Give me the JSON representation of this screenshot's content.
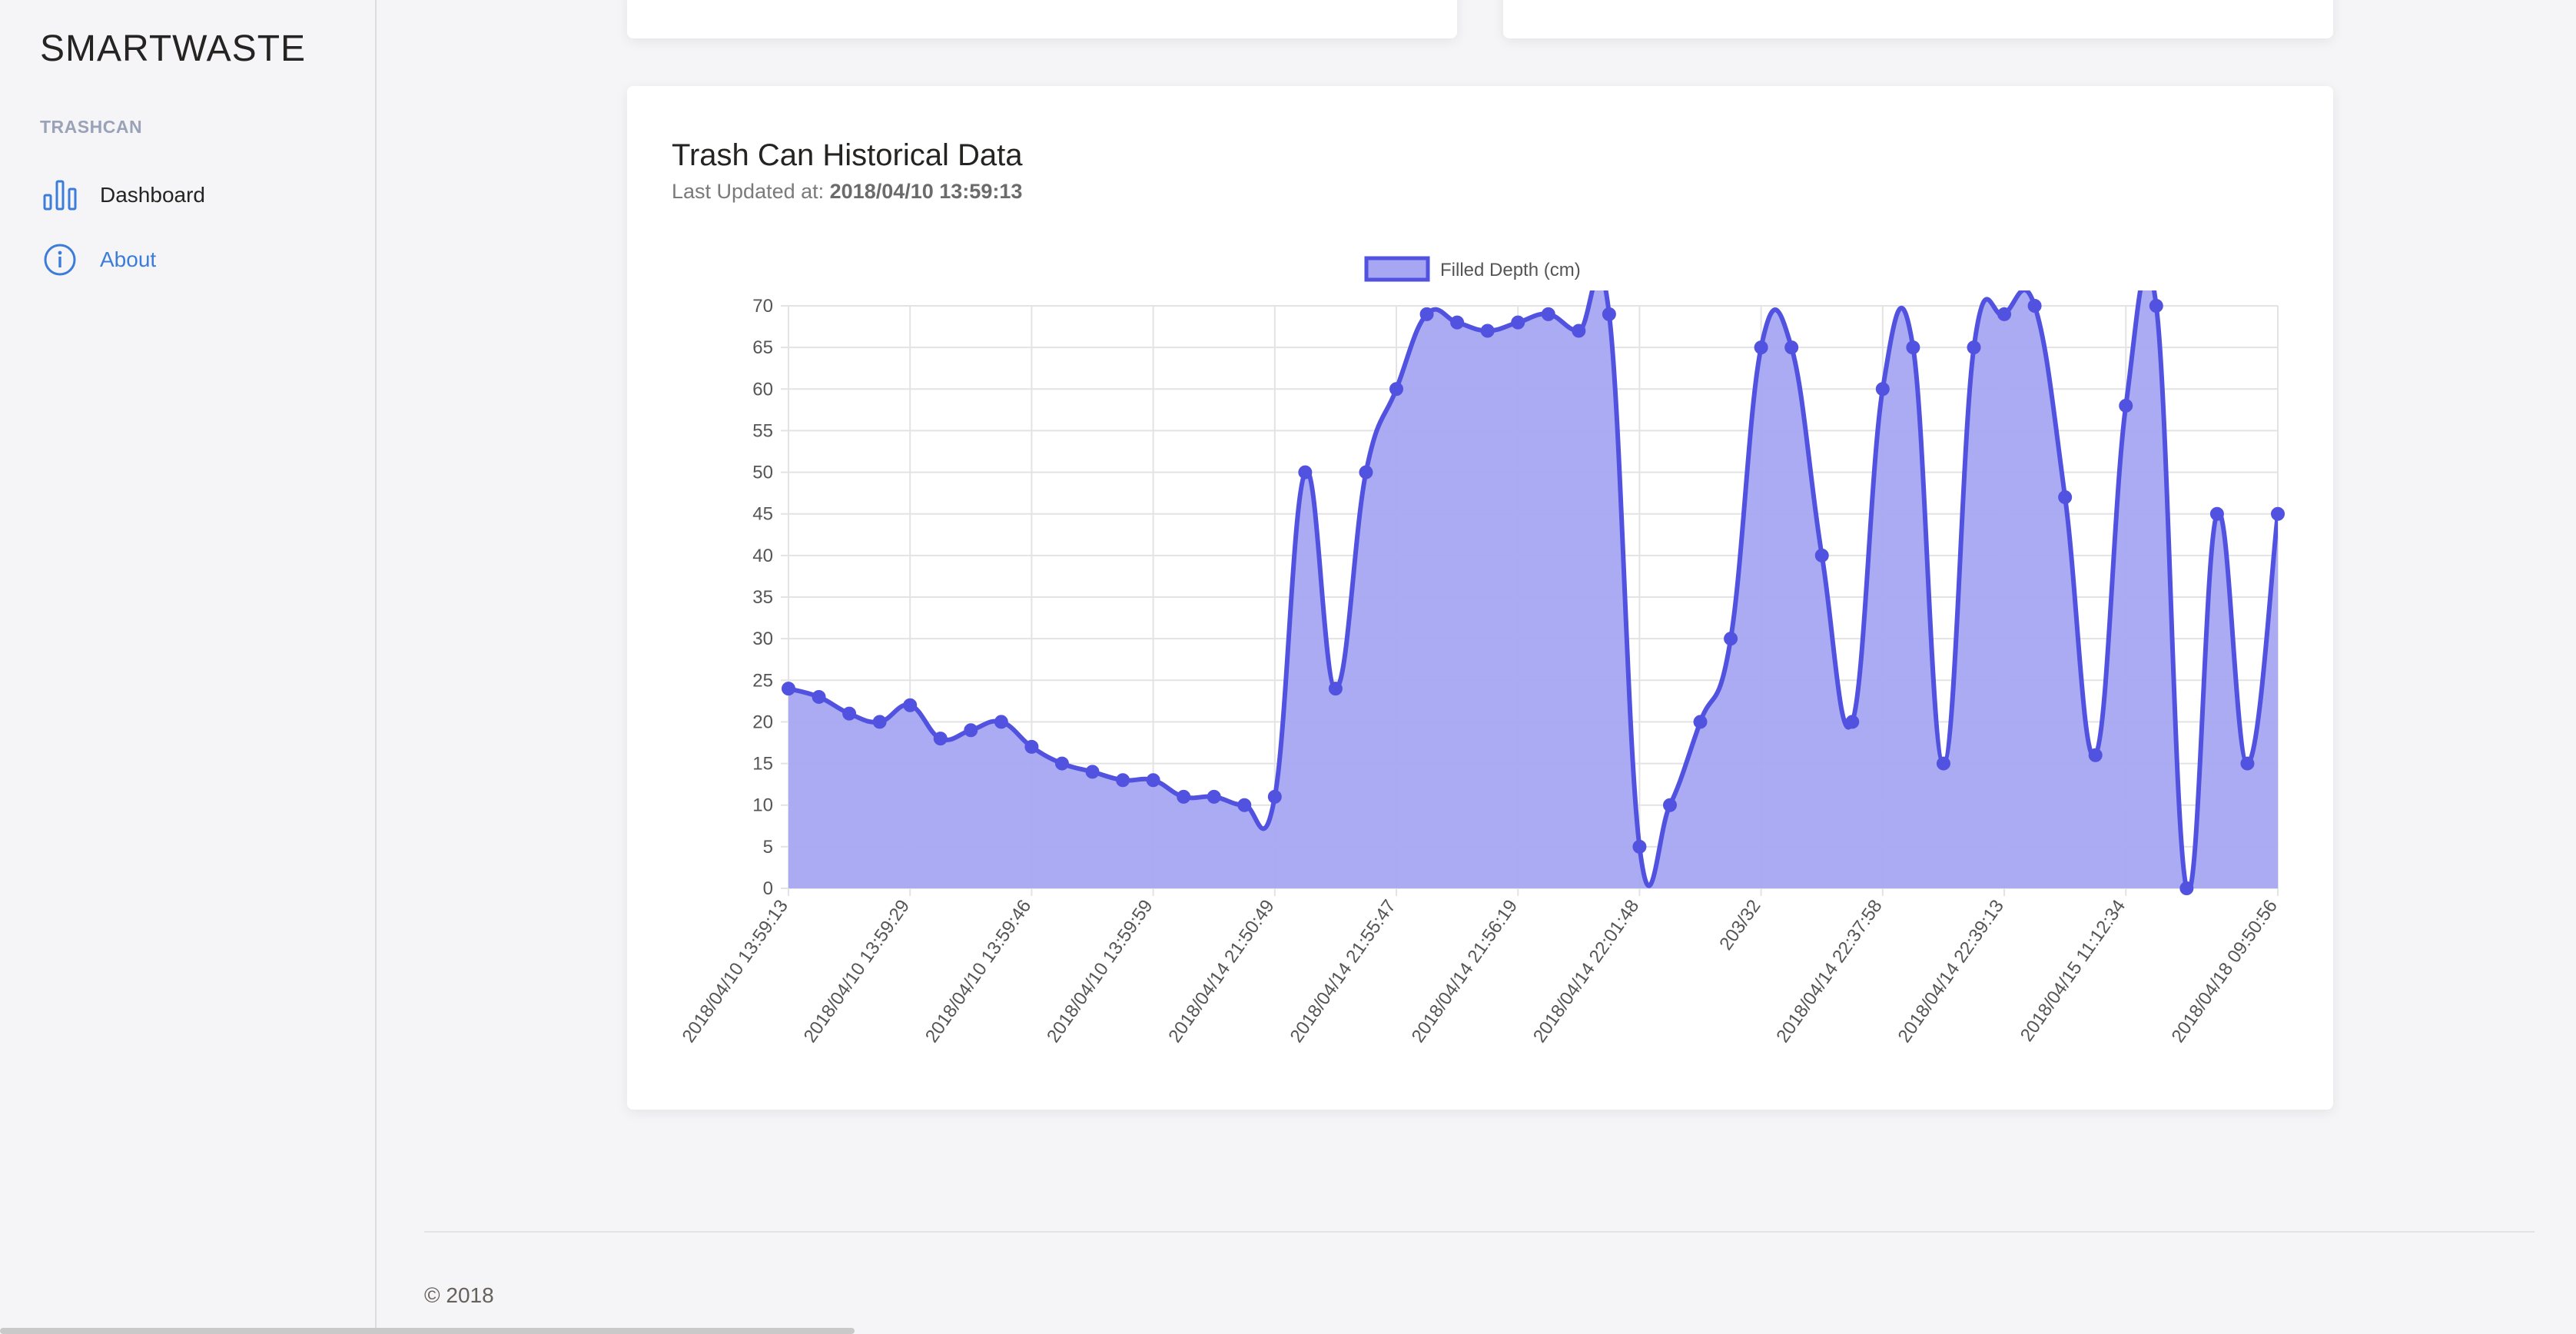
{
  "sidebar": {
    "brand": "SMARTWASTE",
    "section_title": "TRASHCAN",
    "items": [
      {
        "label": "Dashboard",
        "icon": "bar-chart-icon"
      },
      {
        "label": "About",
        "icon": "info-icon"
      }
    ]
  },
  "card": {
    "title": "Trash Can Historical Data",
    "subtitle_prefix": "Last Updated at: ",
    "subtitle_value": "2018/04/10 13:59:13"
  },
  "footer": {
    "text": "© 2018"
  },
  "colors": {
    "accent": "#3b7dd8",
    "series_line": "#5252e0",
    "series_fill": "#a6a6f2"
  },
  "chart_data": {
    "type": "area",
    "legend": [
      "Filled Depth (cm)"
    ],
    "legend_position": "top",
    "grid": true,
    "ylim": [
      0,
      70
    ],
    "yticks": [
      0,
      5,
      10,
      15,
      20,
      25,
      30,
      35,
      40,
      45,
      50,
      55,
      60,
      65,
      70
    ],
    "xtick_labels": [
      {
        "index": 0,
        "label": "2018/04/10 13:59:13"
      },
      {
        "index": 4,
        "label": "2018/04/10 13:59:29"
      },
      {
        "index": 8,
        "label": "2018/04/10 13:59:46"
      },
      {
        "index": 12,
        "label": "2018/04/10 13:59:59"
      },
      {
        "index": 16,
        "label": "2018/04/14 21:50:49"
      },
      {
        "index": 20,
        "label": "2018/04/14 21:55:47"
      },
      {
        "index": 24,
        "label": "2018/04/14 21:56:19"
      },
      {
        "index": 28,
        "label": "2018/04/14 22:01:48"
      },
      {
        "index": 32,
        "label": "203/32"
      },
      {
        "index": 36,
        "label": "2018/04/14 22:37:58"
      },
      {
        "index": 40,
        "label": "2018/04/14 22:39:13"
      },
      {
        "index": 44,
        "label": "2018/04/15 11:12:34"
      },
      {
        "index": 49,
        "label": "2018/04/18 09:50:56"
      }
    ],
    "series": [
      {
        "name": "Filled Depth (cm)",
        "values": [
          24,
          23,
          21,
          20,
          22,
          18,
          19,
          20,
          17,
          15,
          14,
          13,
          13,
          11,
          11,
          10,
          11,
          50,
          24,
          50,
          60,
          69,
          68,
          67,
          68,
          69,
          67,
          69,
          5,
          10,
          20,
          30,
          65,
          65,
          40,
          20,
          60,
          65,
          15,
          65,
          69,
          70,
          47,
          16,
          58,
          70,
          0,
          45,
          15,
          45
        ]
      }
    ]
  }
}
